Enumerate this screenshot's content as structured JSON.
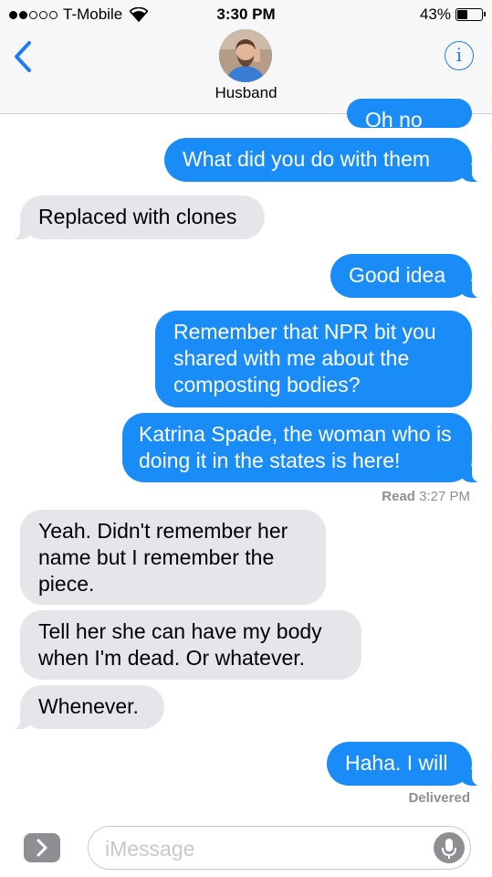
{
  "status_bar": {
    "carrier": "T-Mobile",
    "time": "3:30 PM",
    "battery_percent": "43%",
    "battery_level": 0.43,
    "signal_bars_filled": 2,
    "signal_bars_total": 5
  },
  "header": {
    "contact_name": "Husband",
    "back_icon": "chevron-left-icon",
    "info_icon": "info-icon",
    "info_glyph": "i",
    "accent_color": "#1d7cf5"
  },
  "messages": [
    {
      "from": "me",
      "text": "Oh no"
    },
    {
      "from": "me",
      "text": "What did you do with them"
    },
    {
      "from": "them",
      "text": "Replaced with clones"
    },
    {
      "from": "me",
      "text": "Good idea"
    },
    {
      "from": "me",
      "text": "Remember that NPR bit you shared with me about the composting bodies?"
    },
    {
      "from": "me",
      "text": "Katrina Spade, the woman who is doing it in the states is here!"
    },
    {
      "from": "them",
      "text": "Yeah. Didn't remember her name but I remember the piece."
    },
    {
      "from": "them",
      "text": "Tell her she can have my body when I'm dead. Or whatever."
    },
    {
      "from": "them",
      "text": "Whenever."
    },
    {
      "from": "me",
      "text": "Haha. I will"
    }
  ],
  "receipts": {
    "read_label": "Read",
    "read_time": "3:27 PM",
    "delivered": "Delivered"
  },
  "composer": {
    "placeholder": "iMessage",
    "expand_icon": "chevron-right-icon",
    "mic_icon": "microphone-icon"
  },
  "colors": {
    "outgoing_bubble": "#1a8cf7",
    "incoming_bubble": "#e5e5ea",
    "header_bg": "#f7f7f7"
  }
}
